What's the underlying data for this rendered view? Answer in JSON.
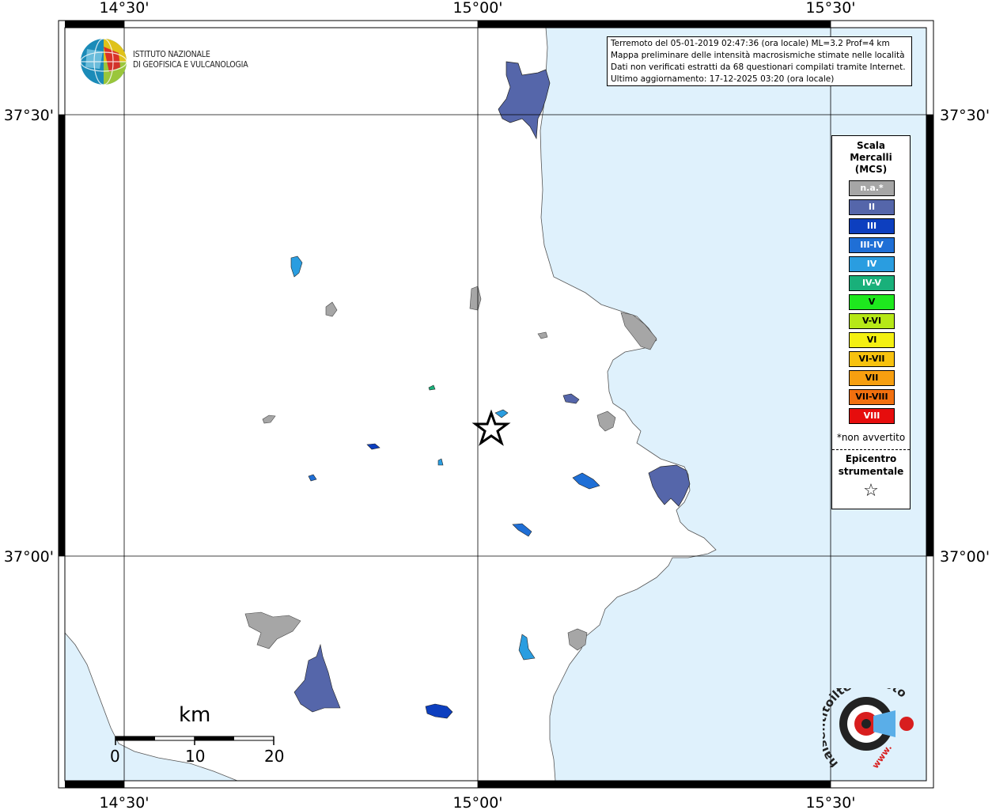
{
  "map": {
    "top_ticks": [
      "14°30'",
      "15°00'",
      "15°30'"
    ],
    "bottom_ticks": [
      "14°30'",
      "15°00'",
      "15°30'"
    ],
    "left_ticks": [
      "37°30'",
      "37°00'"
    ],
    "right_ticks": [
      "37°30'",
      "37°00'"
    ],
    "colors": {
      "sea": "#dff1fc",
      "land": "#ffffff",
      "frame": "#000000"
    }
  },
  "info": {
    "line1": "Terremoto del 05-01-2019 02:47:36 (ora locale) ML=3.2 Prof=4 km",
    "line2": "Mappa preliminare delle intensità macrosismiche stimate nelle località",
    "line3": "Dati non verificati estratti da 68 questionari compilati tramite Internet.",
    "line4": "Ultimo aggiornamento: 17-12-2025 03:20 (ora locale)"
  },
  "logo": {
    "line1": "ISTITUTO NAZIONALE",
    "line2": "DI GEOFISICA E VULCANOLOGIA"
  },
  "legend": {
    "title1": "Scala",
    "title2": "Mercalli",
    "title3": "(MCS)",
    "items": [
      {
        "label": "n.a.*",
        "color": "#a6a6a6"
      },
      {
        "label": "II",
        "color": "#5566aa"
      },
      {
        "label": "III",
        "color": "#0d3fbf"
      },
      {
        "label": "III-IV",
        "color": "#1f6fd6"
      },
      {
        "label": "IV",
        "color": "#2a9de0"
      },
      {
        "label": "IV-V",
        "color": "#19b07a"
      },
      {
        "label": "V",
        "color": "#1ee81e"
      },
      {
        "label": "V-VI",
        "color": "#b6e817"
      },
      {
        "label": "VI",
        "color": "#f4f012"
      },
      {
        "label": "VI-VII",
        "color": "#f7c20f"
      },
      {
        "label": "VII",
        "color": "#f79f10"
      },
      {
        "label": "VII-VIII",
        "color": "#f2700f"
      },
      {
        "label": "VIII",
        "color": "#e60d0d"
      }
    ],
    "note": "*non avvertito",
    "epi1": "Epicentro",
    "epi2": "strumentale",
    "epi_symbol": "☆"
  },
  "scalebar": {
    "unit": "km",
    "labels": [
      "0",
      "10",
      "20"
    ]
  },
  "hsit": {
    "text": "haisentitoilterremoto.it",
    "www": "www."
  }
}
